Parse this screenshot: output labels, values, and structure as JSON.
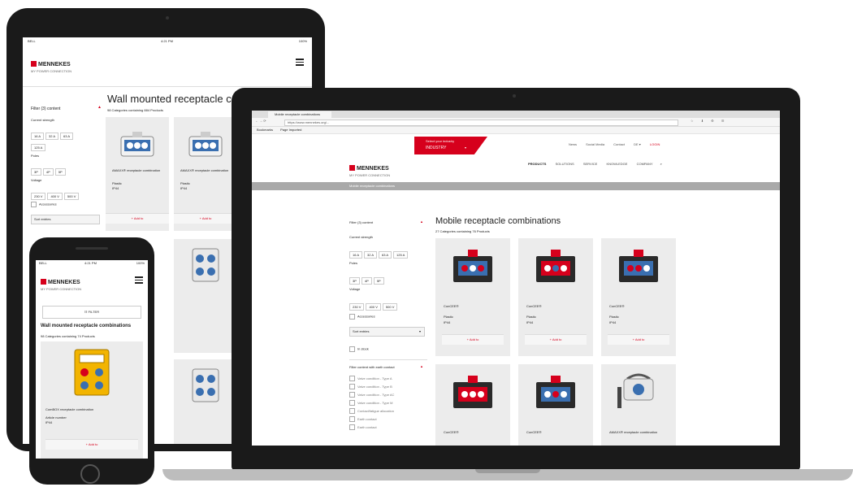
{
  "tablet": {
    "status": {
      "carrier": "BELL",
      "time": "4:21 PM",
      "battery": "100%"
    },
    "brand": "MENNEKES",
    "tagline": "MY POWER CONNECTION",
    "filter_title": "Filter (3) content",
    "page_title": "Wall mounted receptacle combinations",
    "subtitle": "98 Categories containing 884 Products",
    "current_label": "Current strength",
    "current_values": [
      "16 A",
      "32 A",
      "63 A",
      "125 A"
    ],
    "poles_label": "Poles",
    "poles_values": [
      "3P",
      "4P",
      "5P"
    ],
    "voltage_label": "Voltage",
    "voltage_values": [
      "230 V",
      "400 V",
      "500 V"
    ],
    "accessories_label": "Accessories",
    "sort_label": "Sort entries",
    "products": [
      {
        "name": "AMAXX® receptacle combination",
        "label": "Plastic",
        "ip": "IP44",
        "button": "+ Add to"
      },
      {
        "name": "AMAXX® receptacle combination",
        "label": "Plastic",
        "ip": "IP44",
        "button": "+ Add to"
      }
    ]
  },
  "laptop": {
    "tab_title": "Mobile receptacle combinations",
    "url": "https://www.mennekes.org/...",
    "bookmark1": "Bookmarks",
    "bookmark2": "Page Imported",
    "top_links": [
      "News",
      "Social Media",
      "Contact",
      "DE ▾",
      "LOGIN"
    ],
    "industry_label": "Select your industry",
    "industry_value": "INDUSTRY",
    "brand": "MENNEKES",
    "tagline": "MY POWER CONNECTION",
    "nav": [
      "PRODUCTS",
      "SOLUTIONS",
      "SERVICE",
      "KNOWLEDGE",
      "COMPANY"
    ],
    "breadcrumb": "Mobile receptacle combinations",
    "filter_title": "Filter (3) content",
    "page_title": "Mobile receptacle combinations",
    "subtitle": "27 Categories containing 76 Products",
    "current_label": "Current strength",
    "current_values": [
      "16 A",
      "32 A",
      "63 A",
      "125 A"
    ],
    "poles_label": "Poles",
    "poles_values": [
      "3P",
      "4P",
      "5P"
    ],
    "voltage_label": "Voltage",
    "voltage_values": [
      "230 V",
      "400 V",
      "500 V"
    ],
    "accessories_label": "Accessories",
    "sort_label": "Sort entries",
    "in_stock_label": "In stock",
    "filter2_title": "Filter content with earth contact",
    "filter2_items": [
      "Valve condition - Type A",
      "Valve condition - Type B",
      "Valve condition - Type AC",
      "Valve condition - Type M",
      "Contact/fatigue allocation",
      "Earth contact",
      "Earth contact"
    ],
    "products": [
      {
        "name": "ConCEE®",
        "label": "Plastic",
        "ip": "IP44",
        "button": "+ Add to"
      },
      {
        "name": "ConCEE®",
        "label": "Plastic",
        "ip": "IP44",
        "button": "+ Add to"
      },
      {
        "name": "ConCEE®",
        "label": "Plastic",
        "ip": "IP44",
        "button": "+ Add to"
      },
      {
        "name": "ConCEE®",
        "label": "",
        "ip": "",
        "button": ""
      },
      {
        "name": "ConCEE®",
        "label": "",
        "ip": "",
        "button": ""
      },
      {
        "name": "AMAXX® receptacle combination",
        "label": "",
        "ip": "",
        "button": ""
      }
    ]
  },
  "phone": {
    "status": {
      "carrier": "BELL",
      "time": "4:21 PM",
      "battery": "100%"
    },
    "brand": "MENNEKES",
    "tagline": "MY POWER CONNECTION",
    "filter_button": "FILTER",
    "page_title": "Wall mounted receptacle combinations",
    "subtitle": "98 Categories containing 74 Products",
    "product": {
      "name": "ComBOX receptacle combination",
      "label": "Article number",
      "ip": "IP44",
      "button": "+ Add to"
    }
  },
  "colors": {
    "brand_red": "#d6001c",
    "device_black": "#1a1a1a",
    "card_gray": "#ececec"
  }
}
